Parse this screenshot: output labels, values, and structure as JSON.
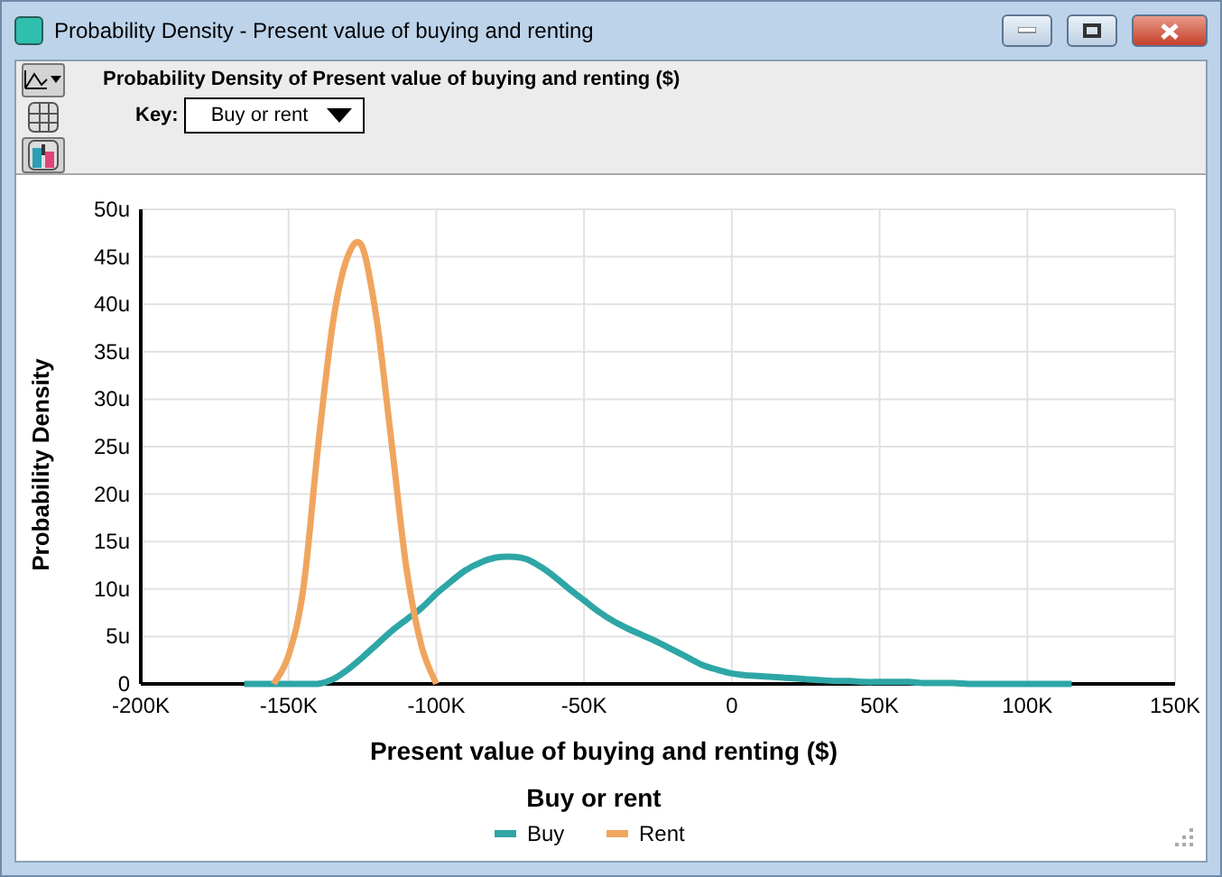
{
  "window": {
    "title": "Probability Density - Present value of buying and renting"
  },
  "header": {
    "title": "Probability Density of Present value of buying and renting ($)",
    "key_label": "Key:",
    "key_value": "Buy or rent"
  },
  "chart": {
    "chart_data": {
      "type": "line",
      "xlabel": "Present value of buying and renting ($)",
      "ylabel": "Probability Density",
      "x": [
        -165000,
        -160000,
        -155000,
        -150000,
        -145000,
        -140000,
        -135000,
        -130000,
        -125000,
        -120000,
        -115000,
        -110000,
        -105000,
        -100000,
        -95000,
        -90000,
        -85000,
        -80000,
        -75000,
        -70000,
        -65000,
        -60000,
        -55000,
        -50000,
        -45000,
        -40000,
        -35000,
        -30000,
        -25000,
        -20000,
        -15000,
        -10000,
        -5000,
        0,
        5000,
        10000,
        15000,
        20000,
        25000,
        30000,
        35000,
        40000,
        45000,
        50000,
        55000,
        60000,
        65000,
        70000,
        75000,
        80000,
        85000,
        90000,
        95000,
        100000,
        105000,
        110000,
        115000
      ],
      "series": [
        {
          "name": "Buy",
          "color": "#2ea6a6",
          "values": [
            0,
            0,
            0,
            0,
            0,
            0,
            0.5,
            1.5,
            2.8,
            4.2,
            5.6,
            6.8,
            8,
            9.5,
            10.8,
            12,
            12.8,
            13.3,
            13.4,
            13.2,
            12.4,
            11.3,
            10,
            8.8,
            7.6,
            6.6,
            5.8,
            5.1,
            4.4,
            3.6,
            2.8,
            2,
            1.5,
            1.1,
            0.9,
            0.8,
            0.7,
            0.6,
            0.5,
            0.4,
            0.3,
            0.3,
            0.2,
            0.2,
            0.2,
            0.2,
            0.1,
            0.1,
            0.1,
            0,
            0,
            0,
            0,
            0,
            0,
            0,
            0
          ]
        },
        {
          "name": "Rent",
          "color": "#f0a55e",
          "values": [
            null,
            null,
            0,
            3,
            10,
            25,
            38,
            45,
            46,
            38,
            25,
            12,
            4,
            0,
            null,
            null,
            null,
            null,
            null,
            null,
            null,
            null,
            null,
            null,
            null,
            null,
            null,
            null,
            null,
            null,
            null,
            null,
            null,
            null,
            null,
            null,
            null,
            null,
            null,
            null,
            null,
            null,
            null,
            null,
            null,
            null,
            null,
            null,
            null,
            null,
            null,
            null,
            null,
            null,
            null,
            null,
            null
          ]
        }
      ],
      "grid": true,
      "legend": "bottom",
      "xlim": [
        -200000,
        150000
      ],
      "ylim": [
        0,
        50
      ],
      "xticks": [
        {
          "value": -200000,
          "label": "-200K"
        },
        {
          "value": -150000,
          "label": "-150K"
        },
        {
          "value": -100000,
          "label": "-100K"
        },
        {
          "value": -50000,
          "label": "-50K"
        },
        {
          "value": 0,
          "label": "0"
        },
        {
          "value": 50000,
          "label": "50K"
        },
        {
          "value": 100000,
          "label": "100K"
        },
        {
          "value": 150000,
          "label": "150K"
        }
      ],
      "yticks": [
        {
          "value": 0,
          "label": "0"
        },
        {
          "value": 5,
          "label": "5u"
        },
        {
          "value": 10,
          "label": "10u"
        },
        {
          "value": 15,
          "label": "15u"
        },
        {
          "value": 20,
          "label": "20u"
        },
        {
          "value": 25,
          "label": "25u"
        },
        {
          "value": 30,
          "label": "30u"
        },
        {
          "value": 35,
          "label": "35u"
        },
        {
          "value": 40,
          "label": "40u"
        },
        {
          "value": 45,
          "label": "45u"
        },
        {
          "value": 50,
          "label": "50u"
        }
      ]
    },
    "legend_title": "Buy or rent"
  }
}
